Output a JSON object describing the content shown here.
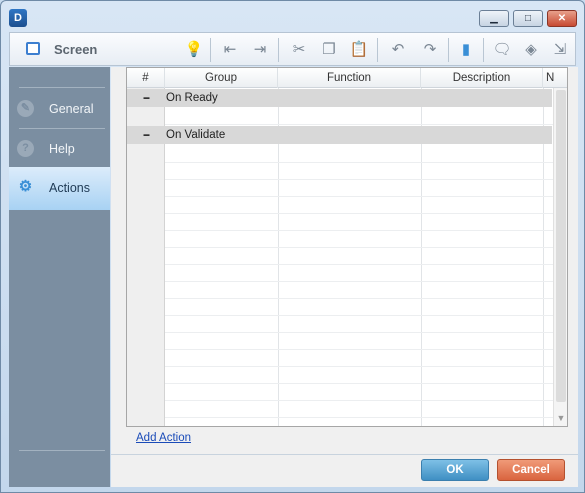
{
  "window": {
    "logo": "D",
    "controls": [
      "minimize",
      "maximize",
      "close"
    ]
  },
  "toolbar": {
    "title": "Screen",
    "icons": [
      "lightbulb-icon",
      "outdent-icon",
      "indent-icon",
      "cut-icon",
      "copy-icon",
      "paste-icon",
      "undo-icon",
      "redo-icon",
      "comment-icon",
      "speech-bubble-icon",
      "diamond-icon",
      "external-link-icon"
    ]
  },
  "sidebar": {
    "items": [
      {
        "label": "General",
        "icon": "pencil-icon"
      },
      {
        "label": "Help",
        "icon": "help-icon"
      },
      {
        "label": "Actions",
        "icon": "gears-icon",
        "active": true
      }
    ]
  },
  "grid": {
    "columns": [
      "#",
      "Group",
      "Function",
      "Description",
      "N"
    ],
    "groups": [
      {
        "toggle": "−",
        "name": "On Ready"
      },
      {
        "toggle": "−",
        "name": "On Validate"
      }
    ]
  },
  "add_action": "Add Action",
  "buttons": {
    "ok": "OK",
    "cancel": "Cancel"
  },
  "colors": {
    "ok": "#4f9fd0",
    "cancel": "#e0734c",
    "sidebar": "#7b8ea1",
    "active_tab": "#bfe0f7"
  }
}
